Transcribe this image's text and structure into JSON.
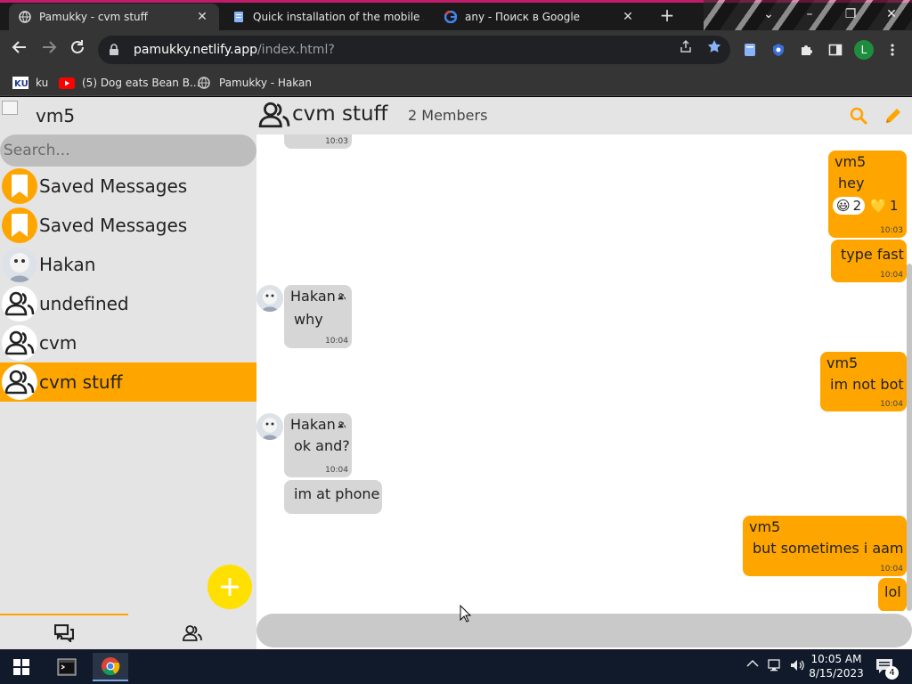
{
  "browser": {
    "tabs": [
      {
        "title": "Pamukky - cvm stuff",
        "active": true,
        "icon": "globe-icon"
      },
      {
        "title": "Quick installation of the mobile s",
        "active": false,
        "icon": "doc-icon"
      },
      {
        "title": "any - Поиск в Google",
        "active": false,
        "icon": "google-icon"
      }
    ],
    "new_tab": "+",
    "window_controls": {
      "dropdown": "⌄",
      "minimize": "–",
      "maximize": "❐",
      "close": "✕"
    },
    "url_host": "pamukky.netlify.app",
    "url_path": "/index.html?",
    "profile_initial": "L",
    "bookmarks": [
      {
        "label": "ku",
        "icon": "ku-icon"
      },
      {
        "label": "(5) Dog eats Bean B...",
        "icon": "youtube-icon"
      },
      {
        "label": "Pamukky - Hakan",
        "icon": "globe-icon"
      }
    ],
    "accent_color": "#c01c6a"
  },
  "app": {
    "accent_color": "#ffa500",
    "fab_color": "#ffe000",
    "user": {
      "name": "vm5"
    },
    "search_placeholder": "Search...",
    "chats": [
      {
        "name": "Saved Messages",
        "type": "saved",
        "active": false
      },
      {
        "name": "Saved Messages",
        "type": "saved",
        "active": false
      },
      {
        "name": "Hakan",
        "type": "user",
        "active": false
      },
      {
        "name": "undefined",
        "type": "group",
        "active": false
      },
      {
        "name": "cvm",
        "type": "group",
        "active": false
      },
      {
        "name": "cvm stuff",
        "type": "group",
        "active": true
      }
    ],
    "fab_label": "+",
    "header": {
      "title": "cvm stuff",
      "members": "2 Members"
    },
    "messages": [
      {
        "dir": "in",
        "sender": "",
        "text": "",
        "time": "10:03",
        "partial": true
      },
      {
        "dir": "out",
        "sender": "vm5",
        "text": "hey",
        "time": "10:03",
        "reactions": [
          {
            "emoji": "😃",
            "count": "2"
          },
          {
            "emoji": "💛",
            "count": "1"
          }
        ]
      },
      {
        "dir": "out",
        "sender": "",
        "text": "type fast",
        "time": "10:04"
      },
      {
        "dir": "in",
        "sender": "Hakan",
        "text": "why",
        "time": "10:04"
      },
      {
        "dir": "out",
        "sender": "vm5",
        "text": "im not bot",
        "time": "10:04"
      },
      {
        "dir": "in",
        "sender": "Hakan",
        "text": "ok and?",
        "time": "10:04"
      },
      {
        "dir": "in",
        "sender": "",
        "text": "im at phone",
        "time": ""
      },
      {
        "dir": "out",
        "sender": "vm5",
        "text": "but sometimes i aam",
        "time": "10:04"
      },
      {
        "dir": "out",
        "sender": "",
        "text": "lol",
        "time": ""
      }
    ]
  },
  "taskbar": {
    "time": "10:05 AM",
    "date": "8/15/2023",
    "notification_count": "4"
  }
}
